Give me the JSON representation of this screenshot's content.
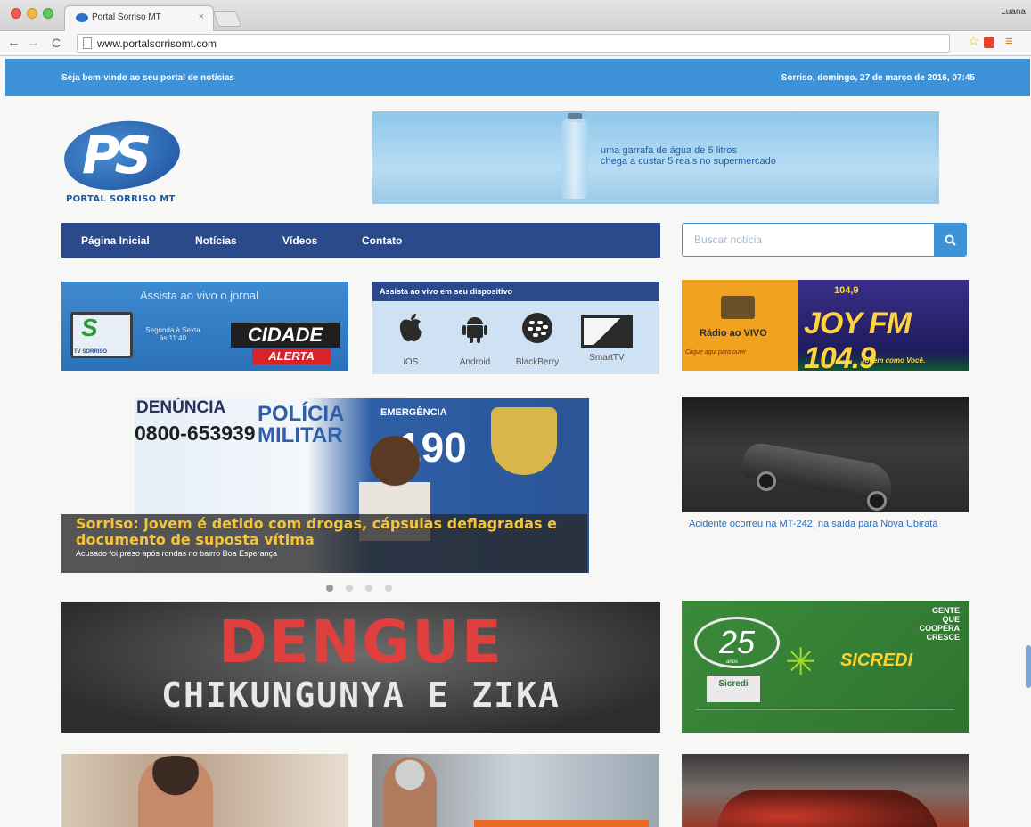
{
  "browser": {
    "tab_title": "Portal Sorriso MT",
    "tab_close": "×",
    "url": "www.portalsorrisomt.com",
    "user": "Luana",
    "back": "←",
    "forward": "→",
    "reload": "C",
    "star": "☆",
    "menu": "≡"
  },
  "topbar": {
    "welcome": "Seja bem-vindo ao seu portal de notícias",
    "datetime": "Sorriso, domingo, 27 de março de 2016, 07:45"
  },
  "logo": {
    "mark": "PS",
    "text": "PORTAL SORRISO MT"
  },
  "banner_ad": {
    "line1": "uma garrafa de água de 5 litros",
    "line2": "chega a custar 5 reais no supermercado"
  },
  "nav": {
    "items": [
      "Página Inicial",
      "Notícias",
      "Vídeos",
      "Contato"
    ]
  },
  "search": {
    "placeholder": "Buscar notícia",
    "button_icon": "search-icon"
  },
  "promo_tv": {
    "heading": "Assista ao vivo o jornal",
    "channel": "TV SORRISO",
    "channel_mark": "S",
    "schedule": "Segunda à Sexta às 11:40",
    "show_line1": "CIDADE",
    "show_line2": "ALERTA"
  },
  "promo_devices": {
    "heading": "Assista ao vivo em seu dispositivo",
    "devices": [
      {
        "label": "iOS",
        "icon": "apple-icon"
      },
      {
        "label": "Android",
        "icon": "android-icon"
      },
      {
        "label": "BlackBerry",
        "icon": "blackberry-icon"
      },
      {
        "label": "SmartTV",
        "icon": "smarttv-icon"
      }
    ]
  },
  "promo_radio": {
    "title": "Rádio ao VIVO",
    "subtitle": "Clique aqui para ouvir",
    "frequency": "104,9",
    "station": "JOY FM 104.9",
    "slogan": "Jovem como Você."
  },
  "headline": {
    "title": "Sorriso: jovem é detido com drogas, cápsulas deflagradas e documento de suposta vítima",
    "subtitle": "Acusado foi preso após rondas no bairro Boa Esperança",
    "photo_texts": {
      "denuncia": "DENÚNCIA",
      "phone": "0800-653939",
      "policia": "POLÍCIA",
      "militar": "MILITAR",
      "emergencia": "EMERGÊNCIA",
      "number": "190"
    },
    "dots_total": 4,
    "dots_active": 1
  },
  "side_news": {
    "caption": "Acidente ocorreu na MT-242, na saída para Nova Ubiratã"
  },
  "dengue_ad": {
    "title": "DENGUE",
    "subtitle": "CHIKUNGUNYA E ZIKA"
  },
  "sicredi_ad": {
    "anniversary": "25",
    "anos": "anos",
    "coop": "Sicredi",
    "brand": "SICREDI",
    "slogan_1": "GENTE",
    "slogan_2": "QUE",
    "slogan_3": "COOPERA",
    "slogan_4": "CRESCE"
  }
}
